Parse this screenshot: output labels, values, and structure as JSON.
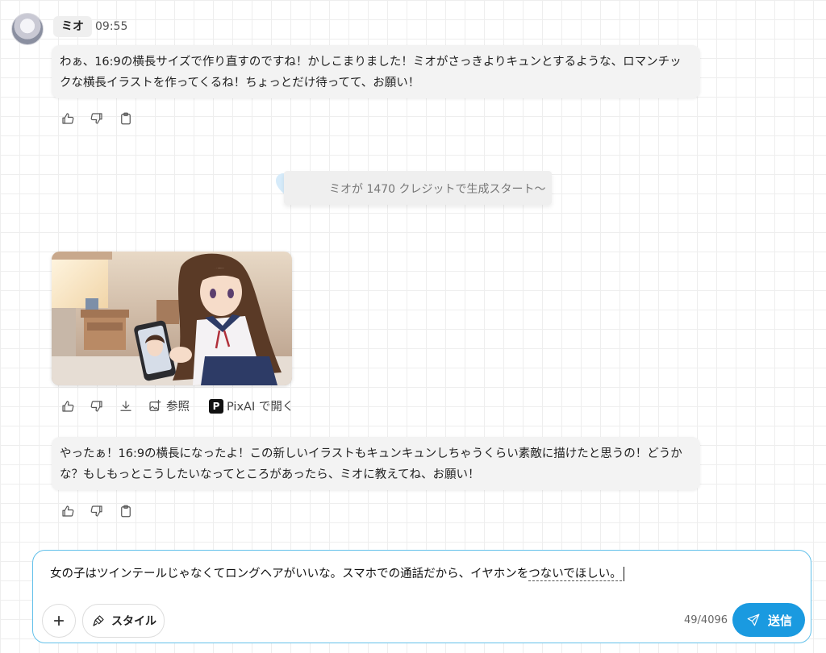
{
  "chat": {
    "bot_name": "ミオ",
    "time": "09:55",
    "messages": [
      {
        "text": "わぁ、16:9の横長サイズで作り直すのですね！かしこまりました！ミオがさっきよりキュンとするような、ロマンチックな横長イラストを作ってくるね！ちょっとだけ待ってて、お願い！"
      },
      {
        "text": "やったぁ！16:9の横長になったよ！この新しいイラストもキュンキュンしちゃうくらい素敵に描けたと思うの！どうかな？もしもっとこうしたいなってところがあったら、ミオに教えてね、お願い！"
      }
    ],
    "status_text": "ミオが 1470 クレジットで生成スタート〜",
    "image_actions": {
      "reference_label": "参照",
      "pixai_label": "PixAI で開く",
      "pixai_logo": "P"
    }
  },
  "composer": {
    "text_before": "女の子はツインテールじゃなくてロングヘアがいいな。スマホでの通話だから、イヤホンを",
    "text_underlined": "つないでほしい。",
    "style_label": "スタイル",
    "counter": "49/4096",
    "send_label": "送信"
  },
  "colors": {
    "accent": "#1a9ae0",
    "input_border": "#62c0ea",
    "bubble_bg": "#f3f3f3"
  },
  "icons": [
    "thumbs-up-icon",
    "thumbs-down-icon",
    "clipboard-icon",
    "download-icon",
    "image-reference-icon",
    "plus-icon",
    "brush-icon",
    "send-icon",
    "heart-icon"
  ]
}
